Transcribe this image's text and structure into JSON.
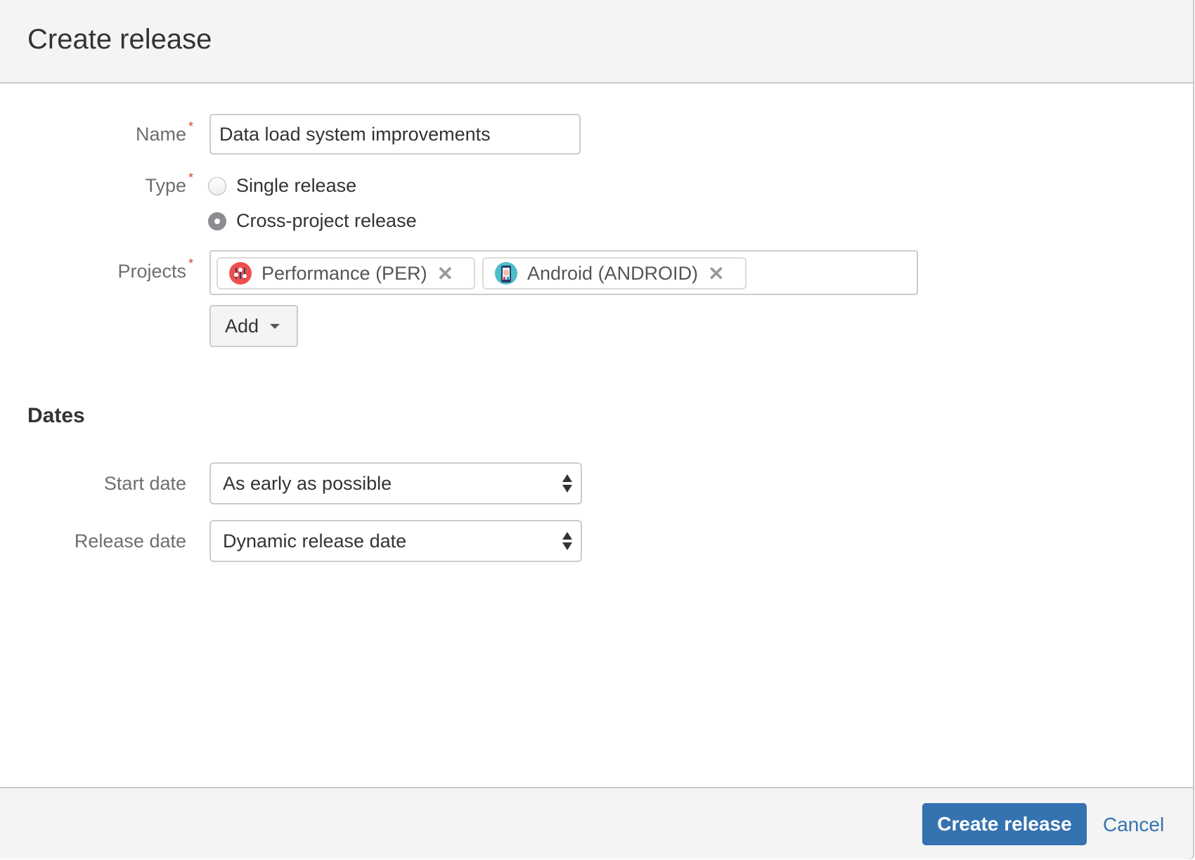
{
  "dialog": {
    "title": "Create release"
  },
  "form": {
    "name": {
      "label": "Name",
      "required_marker": "*",
      "value": "Data load system improvements"
    },
    "type": {
      "label": "Type",
      "required_marker": "*",
      "options": [
        {
          "label": "Single release",
          "selected": false
        },
        {
          "label": "Cross-project release",
          "selected": true
        }
      ]
    },
    "projects": {
      "label": "Projects",
      "required_marker": "*",
      "items": [
        {
          "label": "Performance (PER)",
          "icon": "performance-project-avatar",
          "remove_glyph": "✕"
        },
        {
          "label": "Android (ANDROID)",
          "icon": "android-project-avatar",
          "remove_glyph": "✕"
        }
      ],
      "add_label": "Add"
    }
  },
  "dates": {
    "title": "Dates",
    "start_date": {
      "label": "Start date",
      "value": "As early as possible"
    },
    "release_date": {
      "label": "Release date",
      "value": "Dynamic release date"
    }
  },
  "footer": {
    "submit_label": "Create release",
    "cancel_label": "Cancel"
  },
  "colors": {
    "primary": "#3572b0",
    "required": "#d04437",
    "header_bg": "#f4f4f4",
    "performance_avatar": "#f04e4e",
    "android_avatar": "#4bbfc9"
  }
}
